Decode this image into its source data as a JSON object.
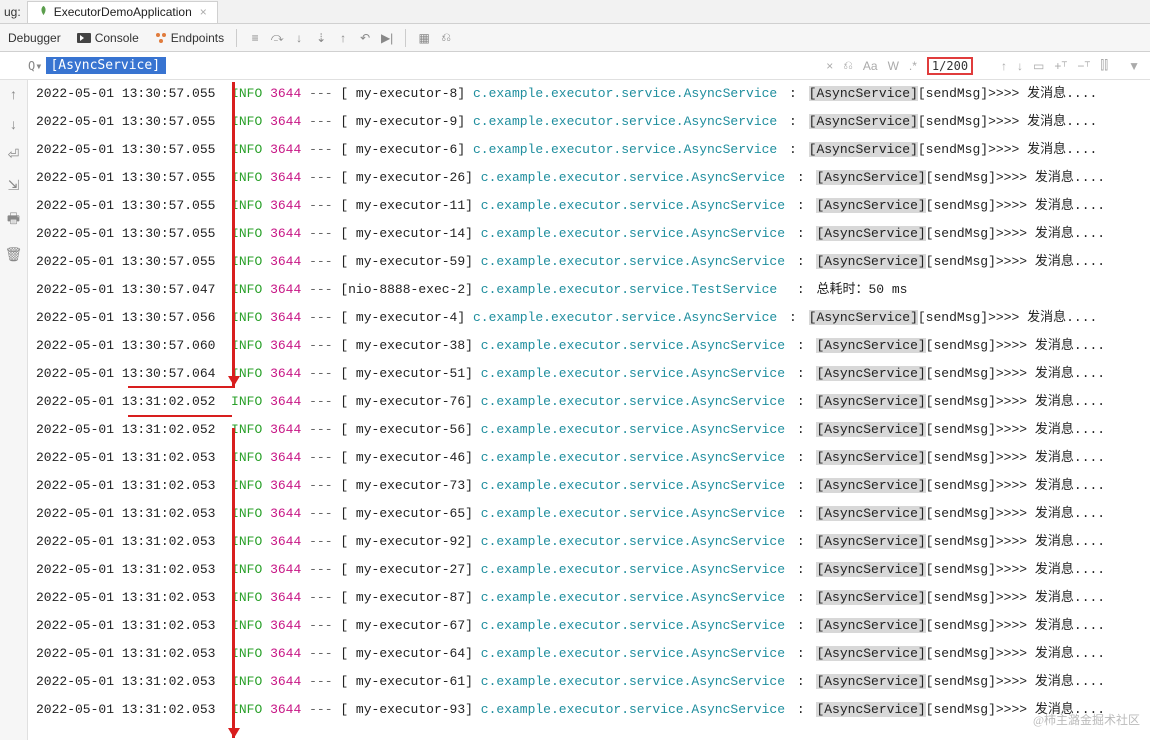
{
  "top": {
    "prefix": "ug:",
    "tab_title": "ExecutorDemoApplication"
  },
  "toolbar": {
    "debugger": "Debugger",
    "console": "Console",
    "endpoints": "Endpoints"
  },
  "search": {
    "prompt": "Q▾",
    "value": "[AsyncService]",
    "count": "1/200",
    "aa": "Aa",
    "w": "W",
    "regex": ".*"
  },
  "log_common": {
    "info": "INFO",
    "pid": "3644",
    "dashes": "---",
    "class_async": "c.example.executor.service.AsyncService",
    "class_test": "c.example.executor.service.TestService",
    "msg_prefix_hl": "[AsyncService]",
    "msg_send": "[sendMsg]>>>> 发消息....",
    "msg_time": "总耗时：50 ms"
  },
  "rows": [
    {
      "ts": "2022-05-01 13:30:57.055",
      "thread": "[  my-executor-8]",
      "type": "async",
      "hl": true
    },
    {
      "ts": "2022-05-01 13:30:57.055",
      "thread": "[  my-executor-9]",
      "type": "async",
      "hl": true
    },
    {
      "ts": "2022-05-01 13:30:57.055",
      "thread": "[  my-executor-6]",
      "type": "async",
      "hl": true
    },
    {
      "ts": "2022-05-01 13:30:57.055",
      "thread": "[ my-executor-26]",
      "type": "async",
      "hl": true
    },
    {
      "ts": "2022-05-01 13:30:57.055",
      "thread": "[ my-executor-11]",
      "type": "async",
      "hl": true
    },
    {
      "ts": "2022-05-01 13:30:57.055",
      "thread": "[ my-executor-14]",
      "type": "async",
      "hl": true
    },
    {
      "ts": "2022-05-01 13:30:57.055",
      "thread": "[ my-executor-59]",
      "type": "async",
      "hl": true
    },
    {
      "ts": "2022-05-01 13:30:57.047",
      "thread": "[nio-8888-exec-2]",
      "type": "test",
      "hl": false
    },
    {
      "ts": "2022-05-01 13:30:57.056",
      "thread": "[  my-executor-4]",
      "type": "async",
      "hl": false
    },
    {
      "ts": "2022-05-01 13:30:57.060",
      "thread": "[ my-executor-38]",
      "type": "async",
      "hl": false
    },
    {
      "ts": "2022-05-01 13:30:57.064",
      "thread": "[ my-executor-51]",
      "type": "async",
      "hl": false
    },
    {
      "ts": "2022-05-01 13:31:02.052",
      "thread": "[ my-executor-76]",
      "type": "async",
      "hl": false
    },
    {
      "ts": "2022-05-01 13:31:02.052",
      "thread": "[ my-executor-56]",
      "type": "async",
      "hl": false
    },
    {
      "ts": "2022-05-01 13:31:02.053",
      "thread": "[ my-executor-46]",
      "type": "async",
      "hl": false
    },
    {
      "ts": "2022-05-01 13:31:02.053",
      "thread": "[ my-executor-73]",
      "type": "async",
      "hl": false
    },
    {
      "ts": "2022-05-01 13:31:02.053",
      "thread": "[ my-executor-65]",
      "type": "async",
      "hl": false
    },
    {
      "ts": "2022-05-01 13:31:02.053",
      "thread": "[ my-executor-92]",
      "type": "async",
      "hl": false
    },
    {
      "ts": "2022-05-01 13:31:02.053",
      "thread": "[ my-executor-27]",
      "type": "async",
      "hl": false
    },
    {
      "ts": "2022-05-01 13:31:02.053",
      "thread": "[ my-executor-87]",
      "type": "async",
      "hl": false
    },
    {
      "ts": "2022-05-01 13:31:02.053",
      "thread": "[ my-executor-67]",
      "type": "async",
      "hl": false
    },
    {
      "ts": "2022-05-01 13:31:02.053",
      "thread": "[ my-executor-64]",
      "type": "async",
      "hl": false
    },
    {
      "ts": "2022-05-01 13:31:02.053",
      "thread": "[ my-executor-61]",
      "type": "async",
      "hl": false
    },
    {
      "ts": "2022-05-01 13:31:02.053",
      "thread": "[ my-executor-93]",
      "type": "async",
      "hl": false
    }
  ],
  "watermark": "@柿主潞金掘术社区"
}
